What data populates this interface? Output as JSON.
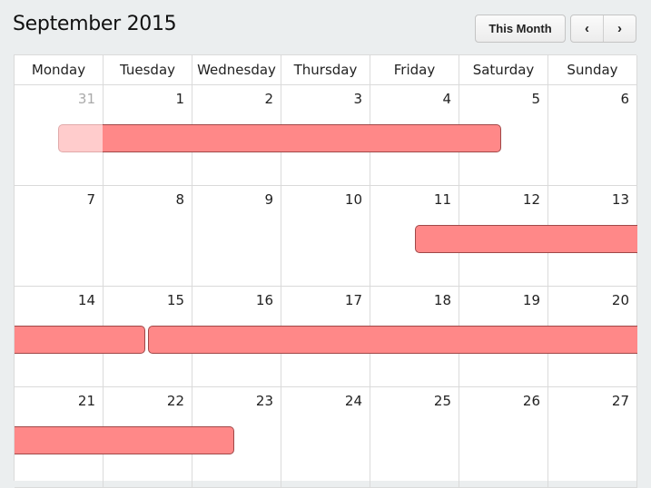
{
  "header": {
    "title": "September 2015",
    "this_month_label": "This Month",
    "prev_icon": "chevron-left-icon",
    "prev_glyph": "‹",
    "next_icon": "chevron-right-icon",
    "next_glyph": "›"
  },
  "weekdays": [
    "Monday",
    "Tuesday",
    "Wednesday",
    "Thursday",
    "Friday",
    "Saturday",
    "Sunday"
  ],
  "weeks": [
    [
      {
        "n": "31",
        "other": true
      },
      {
        "n": "1"
      },
      {
        "n": "2"
      },
      {
        "n": "3"
      },
      {
        "n": "4"
      },
      {
        "n": "5"
      },
      {
        "n": "6"
      }
    ],
    [
      {
        "n": "7"
      },
      {
        "n": "8"
      },
      {
        "n": "9"
      },
      {
        "n": "10"
      },
      {
        "n": "11"
      },
      {
        "n": "12"
      },
      {
        "n": "13"
      }
    ],
    [
      {
        "n": "14"
      },
      {
        "n": "15"
      },
      {
        "n": "16"
      },
      {
        "n": "17"
      },
      {
        "n": "18"
      },
      {
        "n": "19"
      },
      {
        "n": "20"
      }
    ],
    [
      {
        "n": "21"
      },
      {
        "n": "22"
      },
      {
        "n": "23"
      },
      {
        "n": "24"
      },
      {
        "n": "25"
      },
      {
        "n": "26"
      },
      {
        "n": "27"
      }
    ]
  ],
  "colors": {
    "event_fill": "#ff8888",
    "event_border": "#a04848",
    "ghost_fill": "#ffcccc"
  },
  "events": [
    {
      "label": "",
      "week": 0,
      "start_day": "1",
      "end_day": "5",
      "has_ghost_preceding": true
    },
    {
      "label": "",
      "week": 1,
      "start_day": "11",
      "end_day": "13",
      "continues": true
    },
    {
      "label": "",
      "week": 2,
      "start_day": "14",
      "end_day": "14",
      "continued_from_prev": true
    },
    {
      "label": "",
      "week": 2,
      "start_day": "15",
      "end_day": "20",
      "continues": true
    },
    {
      "label": "",
      "week": 3,
      "start_day": "21",
      "end_day": "23",
      "continued_from_prev": true
    }
  ]
}
